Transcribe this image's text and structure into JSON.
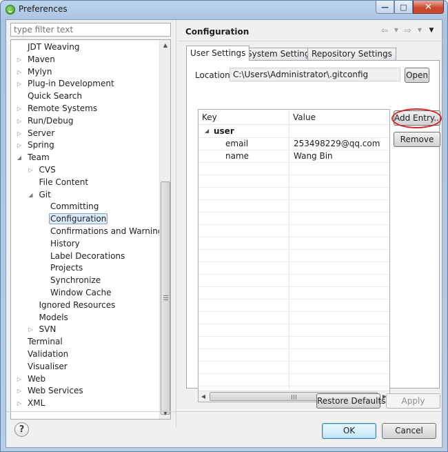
{
  "window": {
    "title": "Preferences",
    "minimize_glyph": "—",
    "maximize_glyph": "□",
    "close_glyph": "✕"
  },
  "filter": {
    "placeholder": "type filter text"
  },
  "tree": {
    "items": [
      {
        "label": "JDT Weaving",
        "expander": "none"
      },
      {
        "label": "Maven",
        "expander": "collapsed"
      },
      {
        "label": "Mylyn",
        "expander": "collapsed"
      },
      {
        "label": "Plug-in Development",
        "expander": "collapsed"
      },
      {
        "label": "Quick Search",
        "expander": "none"
      },
      {
        "label": "Remote Systems",
        "expander": "collapsed"
      },
      {
        "label": "Run/Debug",
        "expander": "collapsed"
      },
      {
        "label": "Server",
        "expander": "collapsed"
      },
      {
        "label": "Spring",
        "expander": "collapsed"
      },
      {
        "label": "Team",
        "expander": "expanded"
      },
      {
        "label": "CVS",
        "expander": "collapsed"
      },
      {
        "label": "File Content",
        "expander": "none"
      },
      {
        "label": "Git",
        "expander": "expanded"
      },
      {
        "label": "Committing",
        "expander": "none"
      },
      {
        "label": "Configuration",
        "expander": "none",
        "selected": true
      },
      {
        "label": "Confirmations and Warnings",
        "expander": "none"
      },
      {
        "label": "History",
        "expander": "none"
      },
      {
        "label": "Label Decorations",
        "expander": "none"
      },
      {
        "label": "Projects",
        "expander": "none"
      },
      {
        "label": "Synchronize",
        "expander": "none"
      },
      {
        "label": "Window Cache",
        "expander": "none"
      },
      {
        "label": "Ignored Resources",
        "expander": "none"
      },
      {
        "label": "Models",
        "expander": "none"
      },
      {
        "label": "SVN",
        "expander": "collapsed"
      },
      {
        "label": "Terminal",
        "expander": "none"
      },
      {
        "label": "Validation",
        "expander": "none"
      },
      {
        "label": "Visualiser",
        "expander": "none"
      },
      {
        "label": "Web",
        "expander": "collapsed"
      },
      {
        "label": "Web Services",
        "expander": "collapsed"
      },
      {
        "label": "XML",
        "expander": "collapsed"
      }
    ]
  },
  "page": {
    "title": "Configuration",
    "nav_back": "⇦",
    "nav_forward": "⇨",
    "nav_menu": "▼",
    "tabs": [
      {
        "label": "User Settings",
        "active": true
      },
      {
        "label": "System Settings",
        "active": false
      },
      {
        "label": "Repository Settings",
        "active": false
      }
    ],
    "location_label": "Location:",
    "location_value": "C:\\Users\\Administrator\\.gitconfig",
    "open_button": "Open",
    "add_entry_button": "Add Entry...",
    "remove_button": "Remove",
    "grid": {
      "columns": [
        "Key",
        "Value"
      ],
      "rows": [
        {
          "key": "user",
          "value": "",
          "group": true
        },
        {
          "key": "email",
          "value": "253498229@qq.com"
        },
        {
          "key": "name",
          "value": "Wang Bin"
        }
      ]
    },
    "restore_defaults_button": "Restore Defaults",
    "apply_button": "Apply"
  },
  "footer": {
    "help_glyph": "?",
    "ok_button": "OK",
    "cancel_button": "Cancel"
  },
  "colors": {
    "title_bar": "#a9c3e0",
    "close_button": "#c9452c",
    "highlight_ring": "#d7262a",
    "selection": "#dcebfc"
  }
}
